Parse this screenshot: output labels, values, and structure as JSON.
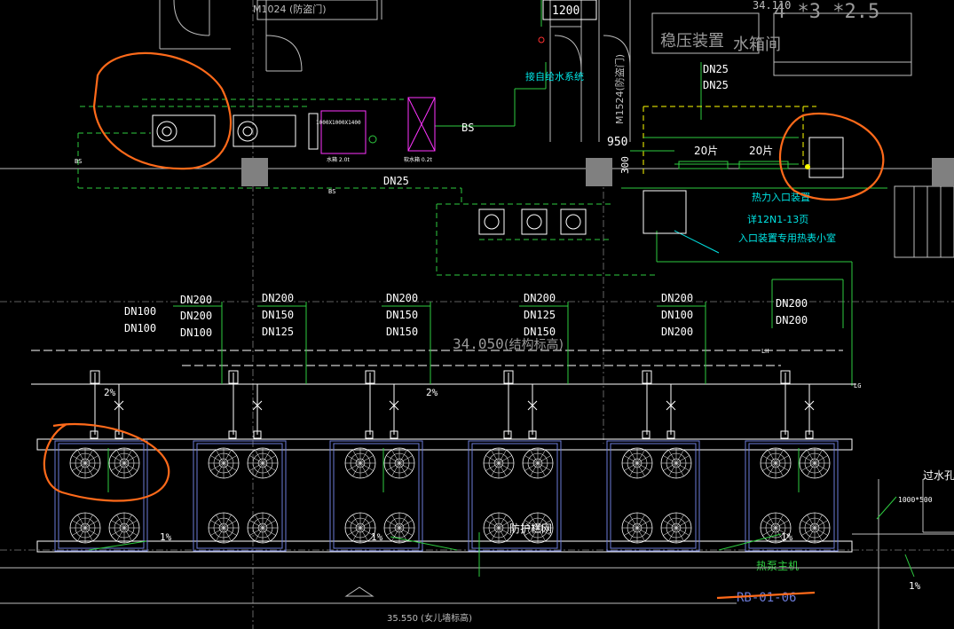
{
  "colors": {
    "background": "#000000",
    "white": "#ffffff",
    "grey": "#bdbdbd",
    "dim": "#7f7f7f",
    "green": "#2ecc40",
    "cyan": "#00e5e5",
    "yellow": "#ffff00",
    "magenta": "#ff33ff",
    "red": "#ff3030",
    "orange_markup": "#ff6a1a",
    "unit_blue": "#6b7bd8",
    "column_fill": "#808080"
  },
  "labels": {
    "door_top": "M1024 (防盗门)",
    "dim_1200": "1200",
    "level_top": "34.110",
    "tank_size": "4 *3 *2.5",
    "pressure_device": "稳压装置",
    "water_tank_room": "水箱间",
    "door_side": "M1524(防盗门)",
    "to_water_system": "接自给水系统",
    "dn25_a": "DN25",
    "dn25_b": "DN25",
    "dn25_c": "DN25",
    "dim_950": "950",
    "dim_300": "300",
    "fins_1": "20片",
    "fins_2": "20片",
    "bs_label": "BS",
    "bs_small_1": "BS",
    "bs_small_2": "BS",
    "softener_box": "1000X1000X1400",
    "water_tank_small": "水箱 2.0t",
    "tank_small_2": "软水箱 0.2t",
    "heat_inlet_device": "热力入口装置",
    "note_line1": "详12N1-13页",
    "note_line2": "入口装置专用热表小室",
    "trunk_dn200_a": "DN200",
    "trunk_dn200_b": "DN200",
    "level_mid": "34.050",
    "structural_level": "(结构标高)",
    "slope_1": "2%",
    "slope_2": "2%",
    "slope_3": "1%",
    "slope_4": "1%",
    "slope_5": "1%",
    "lh": "LH",
    "lg": "LG",
    "anti_vibration": "防护栏网",
    "heat_pump_host": "热泵主机",
    "vent_hole": "过水孔",
    "vent_size": "1000*500",
    "drawing_number": "RB-01-06",
    "parapet_level": "35.550 (女儿墙标高)"
  },
  "branch_groups": [
    {
      "labels": [
        "DN100",
        "DN100"
      ],
      "labels_right": [
        "DN200",
        "DN200",
        "DN100"
      ]
    },
    {
      "labels": [
        "DN200",
        "DN150",
        "DN125"
      ]
    },
    {
      "labels": [
        "DN200",
        "DN150",
        "DN150"
      ]
    },
    {
      "labels": [
        "DN200",
        "DN125",
        "DN150"
      ]
    },
    {
      "labels": [
        "DN200",
        "DN100",
        "DN200"
      ]
    }
  ],
  "heat_pump_units": {
    "count": 6,
    "fans_per_unit": 4
  }
}
